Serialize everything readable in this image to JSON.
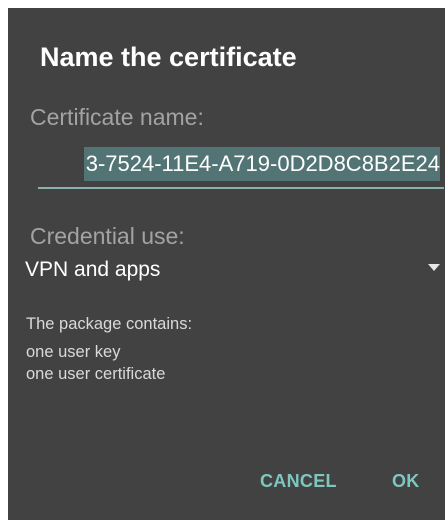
{
  "dialog": {
    "title": "Name the certificate",
    "certificate_name_label": "Certificate name:",
    "certificate_name_value": "3-7524-11E4-A719-0D2D8C8B2E24",
    "credential_use_label": "Credential use:",
    "credential_use_value": "VPN and apps",
    "package_contains_label": "The package contains:",
    "package_items": [
      "one user key",
      "one user certificate"
    ],
    "cancel_label": "CANCEL",
    "ok_label": "OK"
  },
  "colors": {
    "dialog_background": "#424242",
    "accent": "#7ec7c0",
    "selection_highlight": "#537474"
  },
  "icons": {
    "dropdown": "triangle-down"
  }
}
